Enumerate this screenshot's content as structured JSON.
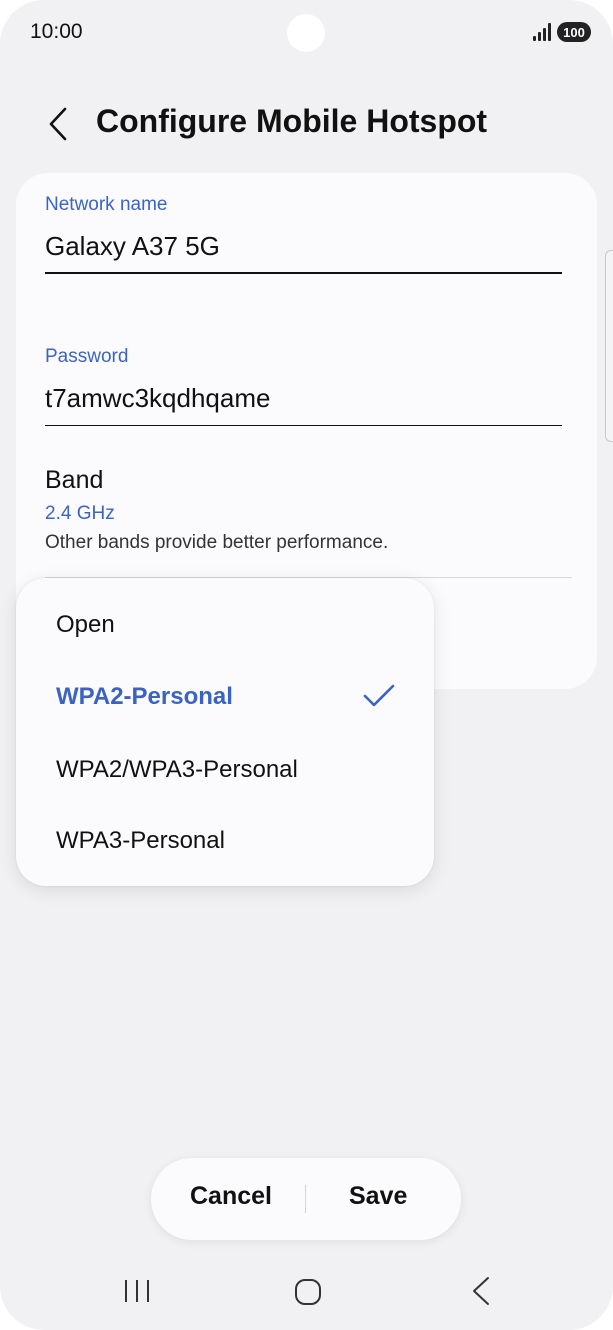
{
  "status_bar": {
    "time": "10:00",
    "battery": "100"
  },
  "header": {
    "title": "Configure Mobile Hotspot"
  },
  "network_name": {
    "label": "Network name",
    "value": "Galaxy A37 5G"
  },
  "password": {
    "label": "Password",
    "value": "t7amwc3kqdhqame"
  },
  "band": {
    "title": "Band",
    "value": "2.4 GHz",
    "description": "Other bands provide better performance."
  },
  "security_dropdown": {
    "options": [
      "Open",
      "WPA2-Personal",
      "WPA2/WPA3-Personal",
      "WPA3-Personal"
    ],
    "selected": "WPA2-Personal"
  },
  "actions": {
    "cancel": "Cancel",
    "save": "Save"
  },
  "colors": {
    "accent": "#3b63c4",
    "background": "#f1f1f3",
    "card": "#fbfbfd"
  },
  "icons": [
    "back-arrow-icon",
    "signal-icon",
    "battery-icon",
    "check-icon",
    "recent-apps-icon",
    "home-icon",
    "nav-back-icon"
  ]
}
